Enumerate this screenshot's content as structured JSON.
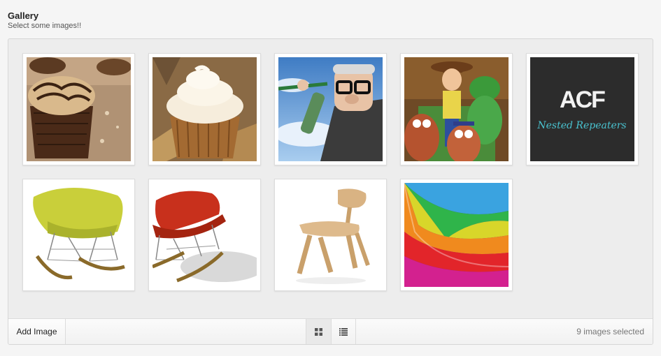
{
  "field": {
    "title": "Gallery",
    "instructions": "Select some images!!"
  },
  "images": [
    {
      "name": "cupcake-chocolate"
    },
    {
      "name": "cupcake-vanilla"
    },
    {
      "name": "up-carl"
    },
    {
      "name": "toy-story"
    },
    {
      "name": "acf-nested-repeaters",
      "logo_text": "ACF",
      "tagline": "Nested Repeaters"
    },
    {
      "name": "yellow-rocking-chair"
    },
    {
      "name": "red-rocking-chair"
    },
    {
      "name": "plywood-chair"
    },
    {
      "name": "rainbow-swirl"
    }
  ],
  "toolbar": {
    "add_label": "Add Image",
    "grid_icon": "grid-view-icon",
    "list_icon": "list-view-icon",
    "count_text": "9 images selected"
  }
}
